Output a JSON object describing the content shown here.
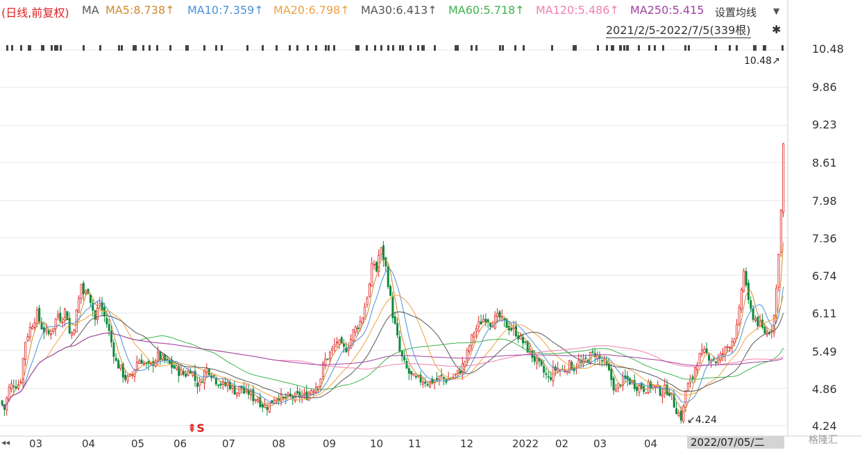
{
  "header": {
    "period_label": "(日线,前复权)",
    "ma_label": "MA",
    "ma_items": [
      {
        "text": "MA5:8.738↑",
        "color": "#d08a2c"
      },
      {
        "text": "MA10:7.359↑",
        "color": "#4a90d9"
      },
      {
        "text": "MA20:6.798↑",
        "color": "#f0a040"
      },
      {
        "text": "MA30:6.413↑",
        "color": "#555555"
      },
      {
        "text": "MA60:5.718↑",
        "color": "#3cb44b"
      },
      {
        "text": "MA120:5.486↑",
        "color": "#f07fb0"
      },
      {
        "text": "MA250:5.415",
        "color": "#a040a0"
      }
    ],
    "settings_label": "设置均线",
    "settings_icon": "triangle-down-icon",
    "range_label": "2021/2/5-2022/7/5(339根)",
    "pin_icon": "pin-icon"
  },
  "colors": {
    "up": "#e02020",
    "down": "#0a8a3a",
    "grid": "#e6e6e6"
  },
  "chart_data": {
    "type": "candlestick",
    "y_ticks": [
      "10.48",
      "9.86",
      "9.23",
      "8.61",
      "7.98",
      "7.36",
      "6.74",
      "6.11",
      "5.49",
      "4.86",
      "4.24"
    ],
    "ylim": [
      4.24,
      10.48
    ],
    "x_ticks": [
      "03",
      "04",
      "05",
      "06",
      "07",
      "08",
      "09",
      "10",
      "11",
      "12",
      "2022",
      "02",
      "03",
      "04"
    ],
    "current_date_label": "2022/07/05/二",
    "max_annotation": "10.48↗",
    "min_annotation": "↙4.24",
    "signal_label": "S",
    "close_path": [
      [
        0,
        4.65
      ],
      [
        5,
        4.5
      ],
      [
        12,
        4.85
      ],
      [
        18,
        4.95
      ],
      [
        24,
        4.9
      ],
      [
        30,
        5.05
      ],
      [
        34,
        5.6
      ],
      [
        40,
        5.8
      ],
      [
        46,
        5.95
      ],
      [
        52,
        6.1
      ],
      [
        58,
        5.9
      ],
      [
        64,
        5.8
      ],
      [
        70,
        5.75
      ],
      [
        76,
        5.9
      ],
      [
        82,
        6.1
      ],
      [
        88,
        6.0
      ],
      [
        94,
        6.2
      ],
      [
        100,
        5.7
      ],
      [
        106,
        5.9
      ],
      [
        112,
        6.3
      ],
      [
        116,
        6.6
      ],
      [
        120,
        6.4
      ],
      [
        126,
        6.5
      ],
      [
        132,
        6.2
      ],
      [
        136,
        6.0
      ],
      [
        142,
        6.3
      ],
      [
        148,
        6.1
      ],
      [
        154,
        5.9
      ],
      [
        160,
        5.6
      ],
      [
        166,
        5.3
      ],
      [
        172,
        5.2
      ],
      [
        178,
        5.05
      ],
      [
        184,
        5.0
      ],
      [
        190,
        5.1
      ],
      [
        196,
        5.3
      ],
      [
        202,
        5.35
      ],
      [
        208,
        5.25
      ],
      [
        214,
        5.2
      ],
      [
        220,
        5.3
      ],
      [
        226,
        5.4
      ],
      [
        232,
        5.35
      ],
      [
        238,
        5.3
      ],
      [
        244,
        5.25
      ],
      [
        250,
        5.2
      ],
      [
        256,
        5.15
      ],
      [
        262,
        5.1
      ],
      [
        268,
        5.1
      ],
      [
        274,
        5.2
      ],
      [
        280,
        5.0
      ],
      [
        286,
        4.9
      ],
      [
        292,
        5.1
      ],
      [
        298,
        5.2
      ],
      [
        304,
        5.1
      ],
      [
        310,
        5.0
      ],
      [
        316,
        4.95
      ],
      [
        322,
        4.9
      ],
      [
        328,
        4.95
      ],
      [
        334,
        4.85
      ],
      [
        340,
        4.8
      ],
      [
        346,
        4.9
      ],
      [
        352,
        4.75
      ],
      [
        358,
        4.8
      ],
      [
        364,
        4.7
      ],
      [
        370,
        4.7
      ],
      [
        376,
        4.6
      ],
      [
        382,
        4.55
      ],
      [
        388,
        4.6
      ],
      [
        394,
        4.7
      ],
      [
        400,
        4.75
      ],
      [
        406,
        4.65
      ],
      [
        412,
        4.7
      ],
      [
        418,
        4.72
      ],
      [
        424,
        4.7
      ],
      [
        430,
        4.75
      ],
      [
        436,
        4.72
      ],
      [
        442,
        4.75
      ],
      [
        448,
        4.85
      ],
      [
        454,
        4.9
      ],
      [
        460,
        5.0
      ],
      [
        466,
        5.3
      ],
      [
        472,
        5.4
      ],
      [
        478,
        5.5
      ],
      [
        484,
        5.65
      ],
      [
        490,
        5.55
      ],
      [
        496,
        5.5
      ],
      [
        502,
        5.6
      ],
      [
        508,
        5.8
      ],
      [
        514,
        5.9
      ],
      [
        520,
        6.0
      ],
      [
        526,
        6.3
      ],
      [
        532,
        6.6
      ],
      [
        536,
        7.0
      ],
      [
        542,
        6.8
      ],
      [
        546,
        7.2
      ],
      [
        550,
        7.1
      ],
      [
        556,
        6.8
      ],
      [
        562,
        6.3
      ],
      [
        566,
        6.0
      ],
      [
        570,
        5.8
      ],
      [
        574,
        5.5
      ],
      [
        580,
        5.3
      ],
      [
        586,
        5.15
      ],
      [
        592,
        5.05
      ],
      [
        598,
        5.0
      ],
      [
        604,
        5.0
      ],
      [
        610,
        5.0
      ],
      [
        616,
        4.95
      ],
      [
        622,
        4.98
      ],
      [
        628,
        5.0
      ],
      [
        634,
        5.05
      ],
      [
        640,
        5.0
      ],
      [
        646,
        5.02
      ],
      [
        652,
        5.05
      ],
      [
        658,
        5.1
      ],
      [
        664,
        5.2
      ],
      [
        670,
        5.35
      ],
      [
        676,
        5.6
      ],
      [
        682,
        5.8
      ],
      [
        688,
        5.9
      ],
      [
        694,
        6.0
      ],
      [
        700,
        6.05
      ],
      [
        706,
        5.95
      ],
      [
        712,
        6.0
      ],
      [
        718,
        6.05
      ],
      [
        724,
        5.95
      ],
      [
        730,
        5.9
      ],
      [
        736,
        5.85
      ],
      [
        742,
        5.8
      ],
      [
        748,
        5.7
      ],
      [
        754,
        5.6
      ],
      [
        760,
        5.5
      ],
      [
        766,
        5.4
      ],
      [
        772,
        5.3
      ],
      [
        778,
        5.2
      ],
      [
        784,
        5.1
      ],
      [
        790,
        5.0
      ],
      [
        796,
        5.15
      ],
      [
        802,
        5.2
      ],
      [
        808,
        5.15
      ],
      [
        814,
        5.2
      ],
      [
        820,
        5.25
      ],
      [
        826,
        5.2
      ],
      [
        832,
        5.3
      ],
      [
        838,
        5.25
      ],
      [
        844,
        5.35
      ],
      [
        850,
        5.4
      ],
      [
        856,
        5.45
      ],
      [
        862,
        5.35
      ],
      [
        868,
        5.3
      ],
      [
        874,
        5.2
      ],
      [
        880,
        5.0
      ],
      [
        886,
        4.8
      ],
      [
        892,
        4.95
      ],
      [
        898,
        5.0
      ],
      [
        904,
        5.0
      ],
      [
        910,
        4.95
      ],
      [
        916,
        4.9
      ],
      [
        922,
        4.9
      ],
      [
        928,
        4.85
      ],
      [
        934,
        4.9
      ],
      [
        940,
        4.9
      ],
      [
        946,
        4.85
      ],
      [
        952,
        4.8
      ],
      [
        958,
        4.85
      ],
      [
        964,
        4.8
      ],
      [
        970,
        4.6
      ],
      [
        976,
        4.45
      ],
      [
        982,
        4.35
      ],
      [
        986,
        4.8
      ],
      [
        990,
        4.9
      ],
      [
        996,
        5.0
      ],
      [
        1002,
        5.3
      ],
      [
        1008,
        5.4
      ],
      [
        1014,
        5.45
      ],
      [
        1020,
        5.4
      ],
      [
        1026,
        5.35
      ],
      [
        1032,
        5.3
      ],
      [
        1038,
        5.4
      ],
      [
        1044,
        5.5
      ],
      [
        1050,
        5.6
      ],
      [
        1056,
        5.7
      ],
      [
        1062,
        5.9
      ],
      [
        1068,
        6.6
      ],
      [
        1072,
        6.9
      ],
      [
        1076,
        6.3
      ],
      [
        1082,
        6.1
      ],
      [
        1088,
        6.0
      ],
      [
        1094,
        5.9
      ],
      [
        1100,
        5.8
      ],
      [
        1106,
        5.8
      ],
      [
        1112,
        5.9
      ],
      [
        1116,
        6.2
      ],
      [
        1120,
        7.0
      ],
      [
        1124,
        7.7
      ],
      [
        1126,
        8.5
      ],
      [
        1130,
        9.5
      ]
    ],
    "ma_smoothing": {
      "MA5": 5,
      "MA10": 10,
      "MA20": 20,
      "MA30": 30,
      "MA60": 60,
      "MA120": 120,
      "MA250": 250
    }
  },
  "branding": {
    "watermark": "格隆汇"
  },
  "nav": {
    "left_arrows": "◂◂"
  }
}
